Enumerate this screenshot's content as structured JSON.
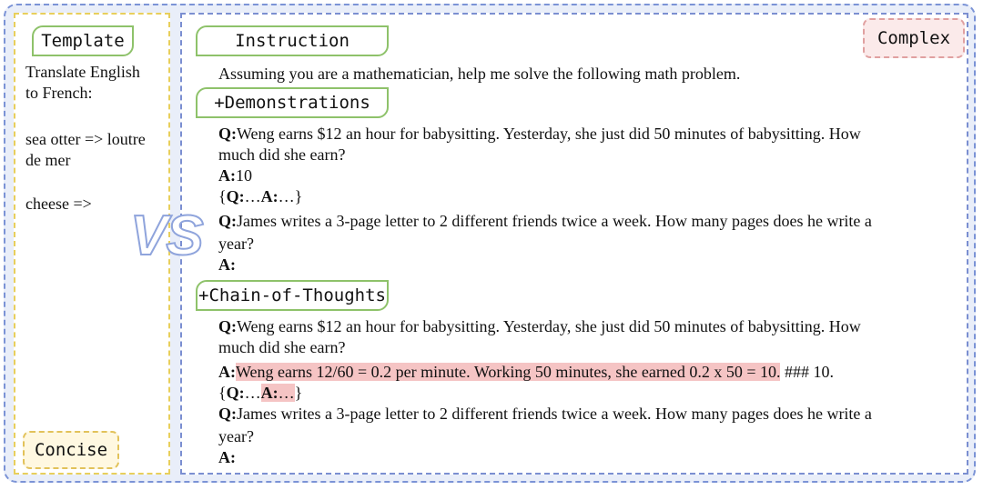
{
  "left": {
    "label": "Template",
    "line1": "Translate English",
    "line2": "to French:",
    "line3": "sea otter => loutre",
    "line4": "de mer",
    "line5": "cheese =>",
    "tag": "Concise"
  },
  "vs": "VS",
  "right": {
    "tag": "Complex",
    "instruction_label": "Instruction",
    "instruction_text": "Assuming you are a mathematician, help me solve the following math problem.",
    "demo_label": "+Demonstrations",
    "cot_label": "+Chain-of-Thoughts",
    "q_marker": "Q:",
    "a_marker": "A:",
    "q1_line1": "Weng earns $12 an hour for babysitting. Yesterday, she just did 50 minutes of babysitting. How",
    "q1_line2": "much did she earn?",
    "demo_a1": "10",
    "ellipsis_open": "{",
    "ellipsis_mid": "…",
    "ellipsis_close": "…}",
    "q2_line1": "James writes a 3-page letter to 2 different friends twice a week. How many pages does he write a",
    "q2_line2": "year?",
    "cot_a1_highlight": "Weng earns 12/60 = 0.2 per minute. Working 50 minutes, she earned 0.2 x 50 = 10.",
    "cot_a1_rest": " ### 10."
  },
  "colors": {
    "outer_border": "#7b93d6",
    "outer_bg": "#e9eef9",
    "left_border": "#e8cf5c",
    "label_border": "#8ec26a",
    "complex_bg": "#fbeaea",
    "concise_bg": "#fff8e1",
    "highlight": "#f5c4c4"
  }
}
